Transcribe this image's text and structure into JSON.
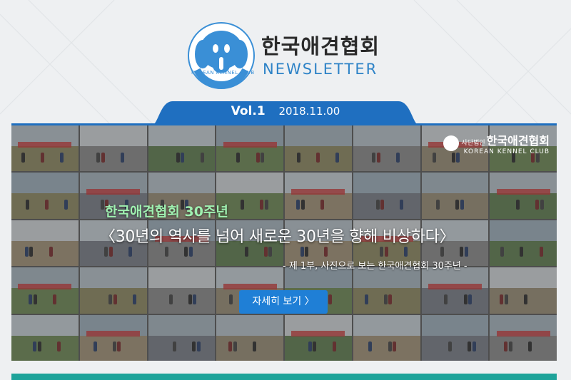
{
  "header": {
    "org_name": "한국애견협회",
    "newsletter": "NEWSLETTER",
    "logo_caption": "KOREAN KENNEL CLUB"
  },
  "issue": {
    "volume": "Vol.1",
    "date": "2018.11.00"
  },
  "hero": {
    "watermark_prefix": "사단법인",
    "watermark_name": "한국애견협회",
    "watermark_en": "KOREAN KENNEL CLUB",
    "subtitle": "한국애견협회 30주년",
    "title": "〈30년의 역사를 넘어 새로운 30년을 향해 비상하다〉",
    "part": "- 제 1부, 사진으로 보는 한국애견협회 30주년 -",
    "button_label": "자세히 보기 〉"
  },
  "colors": {
    "accent": "#1f7fd6",
    "tab": "#1f6fc0",
    "teal": "#1ea39a",
    "subtitle": "#9ff0b0"
  },
  "icons": {
    "logo": "dog-head-icon"
  }
}
